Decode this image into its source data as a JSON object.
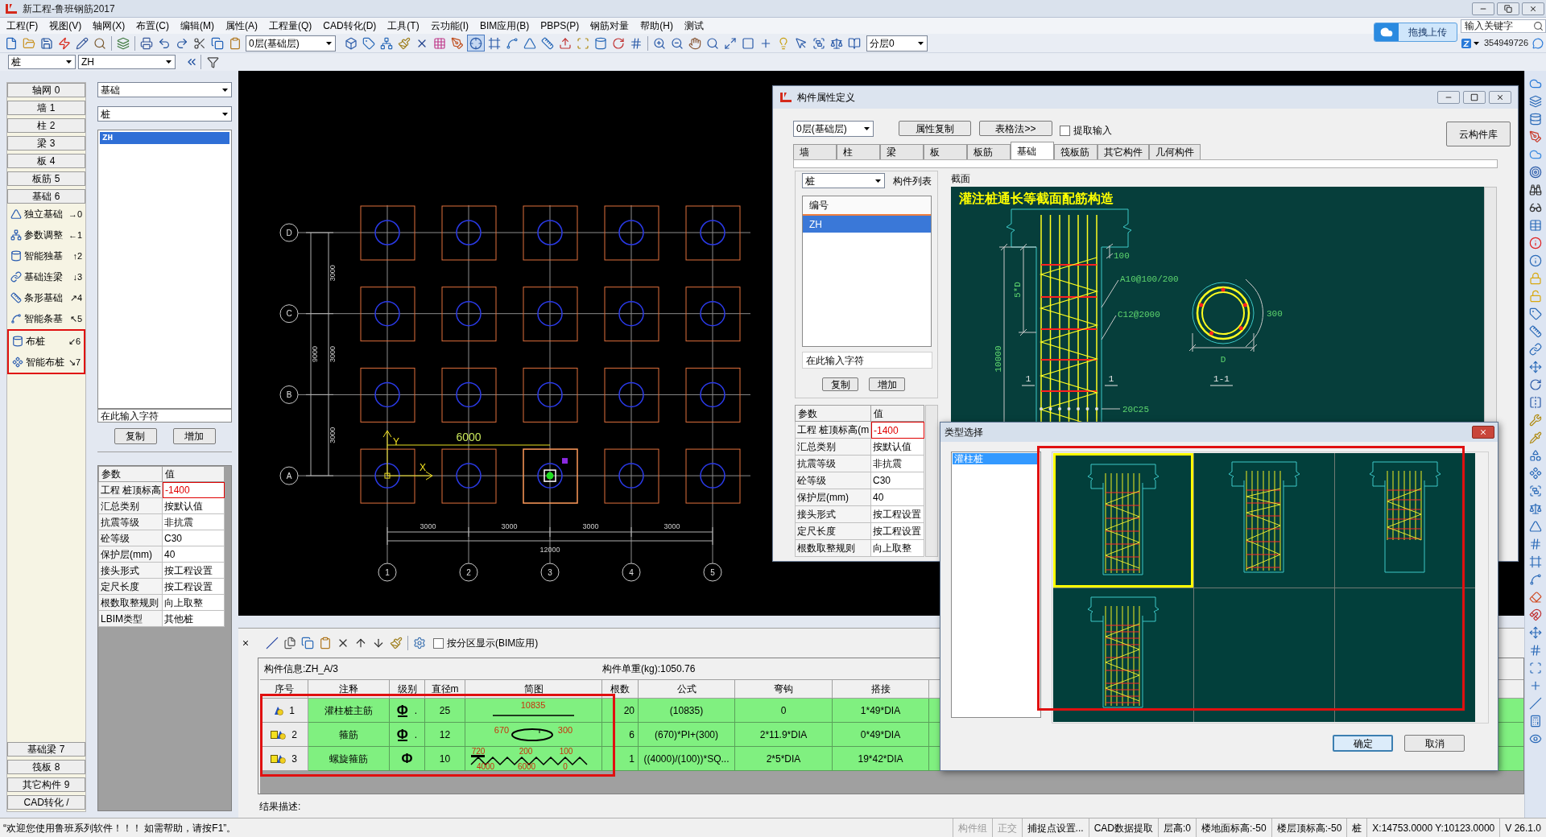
{
  "window": {
    "title": "新工程-鲁班钢筋2017"
  },
  "menu": [
    "工程(F)",
    "视图(V)",
    "轴网(X)",
    "布置(C)",
    "编辑(M)",
    "属性(A)",
    "工程量(Q)",
    "CAD转化(D)",
    "工具(T)",
    "云功能(I)",
    "BIM应用(B)",
    "PBPS(P)",
    "钢筋对量",
    "帮助(H)",
    "测试"
  ],
  "search": {
    "placeholder": "输入关键字"
  },
  "upload_button": "拖拽上传",
  "account": "354949726",
  "toolbar": {
    "floor_select": "0层(基础层)",
    "layer_select": "分层0",
    "toggle": {
      "on": true
    }
  },
  "selector_bar": {
    "type_select": "桩",
    "name_select": "ZH"
  },
  "nav": {
    "categories": [
      "轴网 0",
      "墙 1",
      "柱 2",
      "梁 3",
      "板 4",
      "板筋 5",
      "基础 6"
    ],
    "tools": [
      {
        "label": "独立基础",
        "shortcut": "→0",
        "boxed": false
      },
      {
        "label": "参数调整",
        "shortcut": "←1",
        "boxed": false
      },
      {
        "label": "智能独基",
        "shortcut": "↑2",
        "boxed": false
      },
      {
        "label": "基础连梁",
        "shortcut": "↓3",
        "boxed": false
      },
      {
        "label": "条形基础",
        "shortcut": "↗4",
        "boxed": false
      },
      {
        "label": "智能条基",
        "shortcut": "↖5",
        "boxed": false
      },
      {
        "label": "布桩",
        "shortcut": "↙6",
        "boxed": true
      },
      {
        "label": "智能布桩",
        "shortcut": "↘7",
        "boxed": true
      }
    ],
    "bottom_categories": [
      "基础梁 7",
      "筏板 8",
      "其它构件 9",
      "CAD转化 /"
    ]
  },
  "component_panel": {
    "category_select": "基础",
    "type_select": "桩",
    "items": [
      {
        "label": "ZH",
        "selected": true
      }
    ],
    "filter": {
      "placeholder": "在此输入字符"
    },
    "buttons": [
      "复制",
      "增加"
    ],
    "properties": {
      "columns": [
        "参数",
        "值"
      ],
      "rows": [
        {
          "name": "工程 桩顶标高",
          "value": "-1400",
          "edited": true
        },
        {
          "name": "汇总类别",
          "value": "按默认值",
          "edited": false
        },
        {
          "name": "抗震等级",
          "value": "非抗震",
          "edited": false
        },
        {
          "name": "砼等级",
          "value": "C30",
          "edited": false
        },
        {
          "name": "保护层(mm)",
          "value": "40",
          "edited": false
        },
        {
          "name": "接头形式",
          "value": "按工程设置",
          "edited": false
        },
        {
          "name": "定尺长度",
          "value": "按工程设置",
          "edited": false
        },
        {
          "name": "根数取整规则",
          "value": "向上取整",
          "edited": false
        },
        {
          "name": "LBIM类型",
          "value": "其他桩",
          "edited": false
        }
      ]
    }
  },
  "canvas": {
    "row_axes": [
      "D",
      "C",
      "B",
      "A"
    ],
    "column_axes": [
      "1",
      "2",
      "3",
      "4",
      "5"
    ],
    "row_spacings": [
      "3000",
      "3000",
      "3000"
    ],
    "row_total": "9000",
    "column_spacings": [
      "3000",
      "3000",
      "3000",
      "3000"
    ],
    "column_total": "12000",
    "measure": "6000",
    "ucs": {
      "x": "X",
      "y": "Y"
    },
    "piles": [
      [
        {
          "selected": false
        },
        {
          "selected": false
        },
        {
          "selected": false
        },
        {
          "selected": false
        },
        {
          "selected": false
        }
      ],
      [
        {
          "selected": false
        },
        {
          "selected": false
        },
        {
          "selected": false
        },
        {
          "selected": false
        },
        {
          "selected": false
        }
      ],
      [
        {
          "selected": false
        },
        {
          "selected": false
        },
        {
          "selected": false
        },
        {
          "selected": false
        },
        {
          "selected": false
        }
      ],
      [
        {
          "selected": false
        },
        {
          "selected": false
        },
        {
          "selected": true
        },
        {
          "selected": false
        },
        {
          "selected": false
        }
      ]
    ]
  },
  "property_dialog": {
    "title": "构件属性定义",
    "floor_select": "0层(基础层)",
    "buttons": [
      "属性复制",
      "表格法>>"
    ],
    "extract_input": {
      "label": "提取输入",
      "checked": false
    },
    "cloud_button": "云构件库",
    "tabs": [
      {
        "label": "墙",
        "selected": false
      },
      {
        "label": "柱",
        "selected": false
      },
      {
        "label": "梁",
        "selected": false
      },
      {
        "label": "板",
        "selected": false
      },
      {
        "label": "板筋",
        "selected": false
      },
      {
        "label": "基础",
        "selected": true
      },
      {
        "label": "筏板筋",
        "selected": false
      },
      {
        "label": "其它构件",
        "selected": false
      },
      {
        "label": "几何构件",
        "selected": false
      }
    ],
    "type_select": "桩",
    "list_label": "构件列表",
    "list": {
      "header": "编号",
      "items": [
        {
          "label": "ZH",
          "selected": true
        }
      ]
    },
    "filter": {
      "placeholder": "在此输入字符"
    },
    "list_buttons": [
      "复制",
      "增加"
    ],
    "properties": {
      "columns": [
        "参数",
        "值"
      ],
      "rows": [
        {
          "name": "工程 桩顶标高(m",
          "value": "-1400",
          "edited": true
        },
        {
          "name": "汇总类别",
          "value": "按默认值",
          "edited": false
        },
        {
          "name": "抗震等级",
          "value": "非抗震",
          "edited": false
        },
        {
          "name": "砼等级",
          "value": "C30",
          "edited": false
        },
        {
          "name": "保护层(mm)",
          "value": "40",
          "edited": false
        },
        {
          "name": "接头形式",
          "value": "按工程设置",
          "edited": false
        },
        {
          "name": "定尺长度",
          "value": "按工程设置",
          "edited": false
        },
        {
          "name": "根数取整规则",
          "value": "向上取整",
          "edited": false
        }
      ]
    },
    "section": {
      "label": "截面",
      "title": "灌注桩通长等截面配筋构造",
      "labels": [
        "100",
        "A10@100/200",
        "C12@2000",
        "5*D",
        "10000",
        "1",
        "1",
        "20C25",
        "300",
        "D",
        "1-1"
      ]
    }
  },
  "type_dialog": {
    "title": "类型选择",
    "types": [
      {
        "label": "灌柱桩",
        "selected": true
      }
    ],
    "options": [
      {
        "kind": "uniform",
        "selected": true
      },
      {
        "kind": "dense-top",
        "selected": false
      },
      {
        "kind": "partial",
        "selected": false
      },
      {
        "kind": "dense-ends",
        "selected": false
      }
    ],
    "boxed": true,
    "buttons": [
      {
        "label": "确定",
        "default": true
      },
      {
        "label": "取消",
        "default": false
      }
    ]
  },
  "rebar_panel": {
    "zone_display": {
      "label": "按分区显示(BIM应用)",
      "checked": false
    },
    "info": "构件信息:ZH_A/3",
    "weight": "构件单重(kg):1050.76",
    "columns": [
      "序号",
      "注释",
      "级别",
      "直径m",
      "简图",
      "根数",
      "公式",
      "弯钩",
      "搭接"
    ],
    "rows": [
      {
        "index": "1",
        "tagged": false,
        "name": "灌柱桩主筋",
        "grade": "Φ",
        "grade_bar": true,
        "grade_suffix": ".",
        "diameter": "25",
        "sketch": {
          "kind": "straight",
          "labels": [
            "10835"
          ]
        },
        "count": "20",
        "formula": "(10835)",
        "hook": "0",
        "lap": "1*49*DIA"
      },
      {
        "index": "2",
        "tagged": true,
        "name": "箍筋",
        "grade": "Φ",
        "grade_bar": true,
        "grade_suffix": ".",
        "diameter": "12",
        "sketch": {
          "kind": "hoop",
          "labels": [
            "670",
            "300"
          ]
        },
        "count": "6",
        "formula": "(670)*PI+(300)",
        "hook": "2*11.9*DIA",
        "lap": "0*49*DIA"
      },
      {
        "index": "3",
        "tagged": true,
        "name": "螺旋箍筋",
        "grade": "Φ",
        "grade_bar": false,
        "diameter": "10",
        "sketch": {
          "kind": "spiral",
          "labels": [
            "720",
            "200",
            "100",
            "4000",
            "6000",
            "0"
          ]
        },
        "count": "1",
        "formula": "((4000)/(100))*SQ...",
        "hook": "2*5*DIA",
        "lap": "19*42*DIA"
      }
    ],
    "boxed": true,
    "result_label": "结果描述:"
  },
  "status_bar": {
    "message": "“欢迎您使用鲁班系列软件！！！  如需帮助，请按F1”。",
    "items": [
      {
        "label": "构件组",
        "disabled": true
      },
      {
        "label": "正交",
        "disabled": true
      },
      {
        "label": "捕捉点设置...",
        "disabled": false
      },
      {
        "label": "CAD数据提取",
        "disabled": false
      },
      {
        "label": "层高:0",
        "disabled": false
      },
      {
        "label": "楼地面标高:-50",
        "disabled": false
      },
      {
        "label": "楼层顶标高:-50",
        "disabled": false
      },
      {
        "label": "桩",
        "disabled": false
      },
      {
        "label": "X:14753.0000 Y:10123.0000",
        "disabled": false
      },
      {
        "label": "V 26.1.0",
        "disabled": false
      }
    ]
  }
}
